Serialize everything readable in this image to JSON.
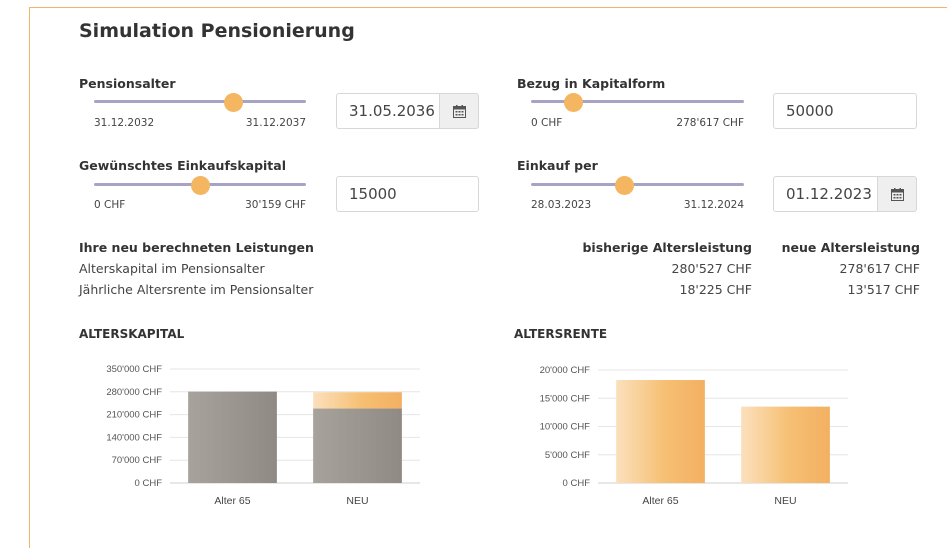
{
  "title": "Simulation Pensionierung",
  "pensionsalter": {
    "label": "Pensionsalter",
    "min_label": "31.12.2032",
    "max_label": "31.12.2037",
    "slider_fraction": 0.66,
    "value": "31.05.2036"
  },
  "bezug": {
    "label": "Bezug in Kapitalform",
    "min_label": "0 CHF",
    "max_label": "278'617 CHF",
    "slider_fraction": 0.2,
    "value": "50000"
  },
  "einkaufskapital": {
    "label": "Gewünschtes Einkaufskapital",
    "min_label": "0 CHF",
    "max_label": "30'159 CHF",
    "slider_fraction": 0.5,
    "value": "15000"
  },
  "einkauf_per": {
    "label": "Einkauf per",
    "min_label": "28.03.2023",
    "max_label": "31.12.2024",
    "slider_fraction": 0.44,
    "value": "01.12.2023"
  },
  "leistungen": {
    "heading": "Ihre neu berechneten Leistungen",
    "col_old": "bisherige Altersleistung",
    "col_new": "neue Altersleistung",
    "rows": [
      {
        "label": "Alterskapital im Pensionsalter",
        "old": "280'527 CHF",
        "new": "278'617 CHF"
      },
      {
        "label": "Jährliche Altersrente im Pensionsalter",
        "old": "18'225 CHF",
        "new": "13'517 CHF"
      }
    ]
  },
  "colors": {
    "accent": "#f4b660",
    "track": "#a7a3c6",
    "grey_bar": "#9a958f"
  },
  "chart_data": [
    {
      "type": "bar",
      "title": "ALTERSKAPITAL",
      "categories": [
        "Alter 65",
        "NEU"
      ],
      "series": [
        {
          "values": [
            280527,
            228617
          ]
        },
        {
          "values": [
            0,
            50000
          ]
        }
      ],
      "stacked": true,
      "ylim": [
        0,
        350000
      ],
      "yticks": [
        0,
        70000,
        140000,
        210000,
        280000,
        350000
      ],
      "ytick_labels": [
        "0 CHF",
        "70'000 CHF",
        "140'000 CHF",
        "210'000 CHF",
        "280'000 CHF",
        "350'000 CHF"
      ],
      "grid": true
    },
    {
      "type": "bar",
      "title": "ALTERSRENTE",
      "categories": [
        "Alter 65",
        "NEU"
      ],
      "values": [
        18225,
        13517
      ],
      "ylim": [
        0,
        20000
      ],
      "yticks": [
        0,
        5000,
        10000,
        15000,
        20000
      ],
      "ytick_labels": [
        "0 CHF",
        "5'000 CHF",
        "10'000 CHF",
        "15'000 CHF",
        "20'000 CHF"
      ],
      "grid": true
    }
  ]
}
